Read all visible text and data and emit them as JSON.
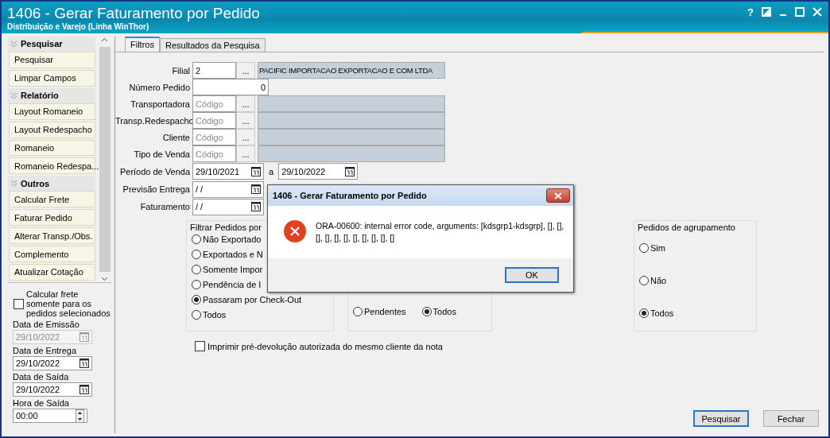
{
  "window": {
    "title": "1406 - Gerar Faturamento por Pedido",
    "subtitle": "Distribuição e Varejo (Linha WinThor)",
    "help_button": "?"
  },
  "sidebar": {
    "sections": [
      {
        "title": "Pesquisar",
        "items": [
          "Pesquisar",
          "Limpar Campos"
        ]
      },
      {
        "title": "Relatório",
        "items": [
          "Layout Romaneio",
          "Layout Redespacho",
          "Romaneio",
          "Romaneio Redespa..."
        ]
      },
      {
        "title": "Outros",
        "items": [
          "Calcular Frete",
          "Faturar Pedido",
          "Alterar Transp./Obs.",
          "Complemento",
          "Atualizar Cotação"
        ]
      }
    ],
    "freight_option": {
      "label": "Calcular frete somente para os pedidos selecionados",
      "checked": false
    },
    "fields": [
      {
        "label": "Data de Emissão",
        "value": "29/10/2022",
        "kind": "date",
        "disabled": true
      },
      {
        "label": "Data de Entrega",
        "value": "29/10/2022",
        "kind": "date",
        "disabled": false
      },
      {
        "label": "Data de Saída",
        "value": "29/10/2022",
        "kind": "date",
        "disabled": false
      },
      {
        "label": "Hora de Saída",
        "value": "00:00",
        "kind": "time",
        "disabled": false
      }
    ]
  },
  "tabs": [
    {
      "label": "Filtros",
      "selected": true
    },
    {
      "label": "Resultados da Pesquisa",
      "selected": false
    }
  ],
  "form": [
    {
      "kind": "lookup",
      "label": "Filial",
      "value": "2",
      "button": "...",
      "description": "PACIFIC IMPORTACAO EXPORTACAO E COM LTDA"
    },
    {
      "kind": "number",
      "label": "Número Pedido",
      "value": "0"
    },
    {
      "kind": "lookup",
      "label": "Transportadora",
      "placeholder": "Código",
      "button": "..."
    },
    {
      "kind": "lookup",
      "label": "Transp.Redespacho",
      "placeholder": "Código",
      "button": "..."
    },
    {
      "kind": "lookup",
      "label": "Cliente",
      "placeholder": "Código",
      "button": "..."
    },
    {
      "kind": "lookup",
      "label": "Tipo de Venda",
      "placeholder": "Código",
      "button": "..."
    },
    {
      "kind": "range",
      "label": "Período de Venda",
      "value": "29/10/2021",
      "separator": "a",
      "value_to": "29/10/2022"
    },
    {
      "kind": "date",
      "label": "Previsão Entrega",
      "value": " / /"
    },
    {
      "kind": "date",
      "label": "Faturamento",
      "value": " / /"
    }
  ],
  "groups": [
    {
      "title": "Filtrar Pedidos por",
      "kind": "column",
      "options": [
        {
          "label": "Não Exportado",
          "selected": false
        },
        {
          "label": "Exportados e N",
          "selected": false
        },
        {
          "label": "Somente Impor",
          "selected": false
        },
        {
          "label": "Pendência de I",
          "selected": false
        },
        {
          "label": "Passaram por Check-Out",
          "selected": true
        },
        {
          "label": "Todos",
          "selected": false
        }
      ]
    },
    {
      "kind": "row",
      "options": [
        {
          "label": "Pendentes",
          "selected": false
        },
        {
          "label": "Todos",
          "selected": true
        }
      ]
    },
    {
      "title": "Pedidos de agrupamento",
      "kind": "spread",
      "options": [
        {
          "label": "Sim",
          "selected": false
        },
        {
          "label": "Não",
          "selected": false
        },
        {
          "label": "Todos",
          "selected": true
        }
      ]
    }
  ],
  "print_option": {
    "label": "Imprimir pré-devolução autorizada do mesmo cliente da nota",
    "checked": false
  },
  "buttons": [
    {
      "label": "Pesquisar",
      "default": true
    },
    {
      "label": "Fechar",
      "default": false
    }
  ],
  "dialog": {
    "title": "1406 - Gerar Faturamento por Pedido",
    "message": "ORA-00600: internal error code, arguments: [kdsgrp1-kdsgrp], [], [], [], [], [], [], [], [], [], [], []",
    "button": "OK"
  }
}
